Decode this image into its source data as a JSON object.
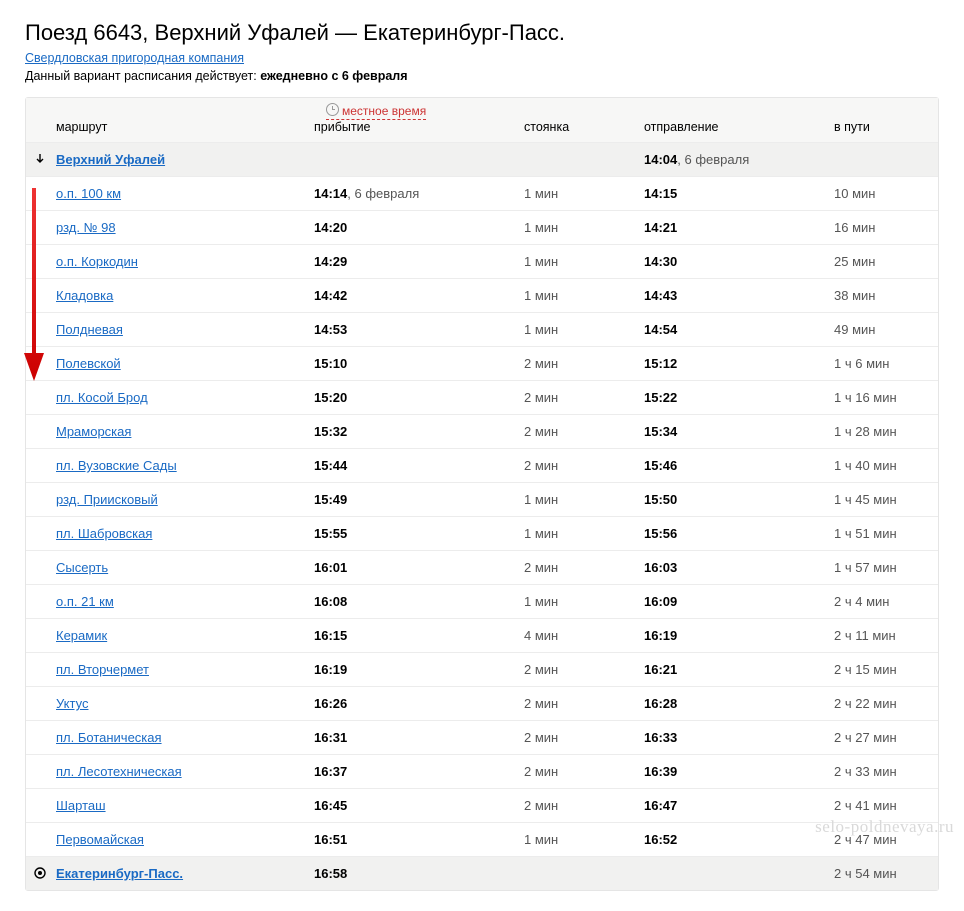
{
  "header": {
    "title": "Поезд 6643, Верхний Уфалей — Екатеринбург-Пасс.",
    "company": "Свердловская пригородная компания",
    "note_prefix": "Данный вариант расписания действует: ",
    "note_bold": "ежедневно с 6 февраля"
  },
  "local_time_label": "местное время",
  "columns": {
    "route": "маршрут",
    "arrival": "прибытие",
    "stop": "стоянка",
    "departure": "отправление",
    "travel": "в пути"
  },
  "rows": [
    {
      "type": "start",
      "station": "Верхний Уфалей",
      "arr": "",
      "arr_date": "",
      "stop": "",
      "dep": "14:04",
      "dep_date": ", 6 февраля",
      "travel": ""
    },
    {
      "type": "mid",
      "station": "о.п. 100 км",
      "arr": "14:14",
      "arr_date": ", 6 февраля",
      "stop": "1 мин",
      "dep": "14:15",
      "dep_date": "",
      "travel": "10 мин"
    },
    {
      "type": "mid",
      "station": "рзд. № 98",
      "arr": "14:20",
      "arr_date": "",
      "stop": "1 мин",
      "dep": "14:21",
      "dep_date": "",
      "travel": "16 мин"
    },
    {
      "type": "mid",
      "station": "о.п. Коркодин",
      "arr": "14:29",
      "arr_date": "",
      "stop": "1 мин",
      "dep": "14:30",
      "dep_date": "",
      "travel": "25 мин"
    },
    {
      "type": "mid",
      "station": "Кладовка",
      "arr": "14:42",
      "arr_date": "",
      "stop": "1 мин",
      "dep": "14:43",
      "dep_date": "",
      "travel": "38 мин"
    },
    {
      "type": "mid",
      "station": "Полдневая",
      "arr": "14:53",
      "arr_date": "",
      "stop": "1 мин",
      "dep": "14:54",
      "dep_date": "",
      "travel": "49 мин"
    },
    {
      "type": "mid",
      "station": "Полевской",
      "arr": "15:10",
      "arr_date": "",
      "stop": "2 мин",
      "dep": "15:12",
      "dep_date": "",
      "travel": "1 ч 6 мин"
    },
    {
      "type": "mid",
      "station": "пл. Косой Брод",
      "arr": "15:20",
      "arr_date": "",
      "stop": "2 мин",
      "dep": "15:22",
      "dep_date": "",
      "travel": "1 ч 16 мин"
    },
    {
      "type": "mid",
      "station": "Мраморская",
      "arr": "15:32",
      "arr_date": "",
      "stop": "2 мин",
      "dep": "15:34",
      "dep_date": "",
      "travel": "1 ч 28 мин"
    },
    {
      "type": "mid",
      "station": "пл. Вузовские Сады",
      "arr": "15:44",
      "arr_date": "",
      "stop": "2 мин",
      "dep": "15:46",
      "dep_date": "",
      "travel": "1 ч 40 мин"
    },
    {
      "type": "mid",
      "station": "рзд. Приисковый",
      "arr": "15:49",
      "arr_date": "",
      "stop": "1 мин",
      "dep": "15:50",
      "dep_date": "",
      "travel": "1 ч 45 мин"
    },
    {
      "type": "mid",
      "station": "пл. Шабровская",
      "arr": "15:55",
      "arr_date": "",
      "stop": "1 мин",
      "dep": "15:56",
      "dep_date": "",
      "travel": "1 ч 51 мин"
    },
    {
      "type": "mid",
      "station": "Сысерть",
      "arr": "16:01",
      "arr_date": "",
      "stop": "2 мин",
      "dep": "16:03",
      "dep_date": "",
      "travel": "1 ч 57 мин"
    },
    {
      "type": "mid",
      "station": "о.п. 21 км",
      "arr": "16:08",
      "arr_date": "",
      "stop": "1 мин",
      "dep": "16:09",
      "dep_date": "",
      "travel": "2 ч 4 мин"
    },
    {
      "type": "mid",
      "station": "Керамик",
      "arr": "16:15",
      "arr_date": "",
      "stop": "4 мин",
      "dep": "16:19",
      "dep_date": "",
      "travel": "2 ч 11 мин"
    },
    {
      "type": "mid",
      "station": "пл. Вторчермет",
      "arr": "16:19",
      "arr_date": "",
      "stop": "2 мин",
      "dep": "16:21",
      "dep_date": "",
      "travel": "2 ч 15 мин"
    },
    {
      "type": "mid",
      "station": "Уктус",
      "arr": "16:26",
      "arr_date": "",
      "stop": "2 мин",
      "dep": "16:28",
      "dep_date": "",
      "travel": "2 ч 22 мин"
    },
    {
      "type": "mid",
      "station": "пл. Ботаническая",
      "arr": "16:31",
      "arr_date": "",
      "stop": "2 мин",
      "dep": "16:33",
      "dep_date": "",
      "travel": "2 ч 27 мин"
    },
    {
      "type": "mid",
      "station": "пл. Лесотехническая",
      "arr": "16:37",
      "arr_date": "",
      "stop": "2 мин",
      "dep": "16:39",
      "dep_date": "",
      "travel": "2 ч 33 мин"
    },
    {
      "type": "mid",
      "station": "Шарташ",
      "arr": "16:45",
      "arr_date": "",
      "stop": "2 мин",
      "dep": "16:47",
      "dep_date": "",
      "travel": "2 ч 41 мин"
    },
    {
      "type": "mid",
      "station": "Первомайская",
      "arr": "16:51",
      "arr_date": "",
      "stop": "1 мин",
      "dep": "16:52",
      "dep_date": "",
      "travel": "2 ч 47 мин"
    },
    {
      "type": "end",
      "station": "Екатеринбург-Пасс.",
      "arr": "16:58",
      "arr_date": "",
      "stop": "",
      "dep": "",
      "dep_date": "",
      "travel": "2 ч 54 мин"
    }
  ],
  "watermark": "selo-poldnevaya.ru"
}
